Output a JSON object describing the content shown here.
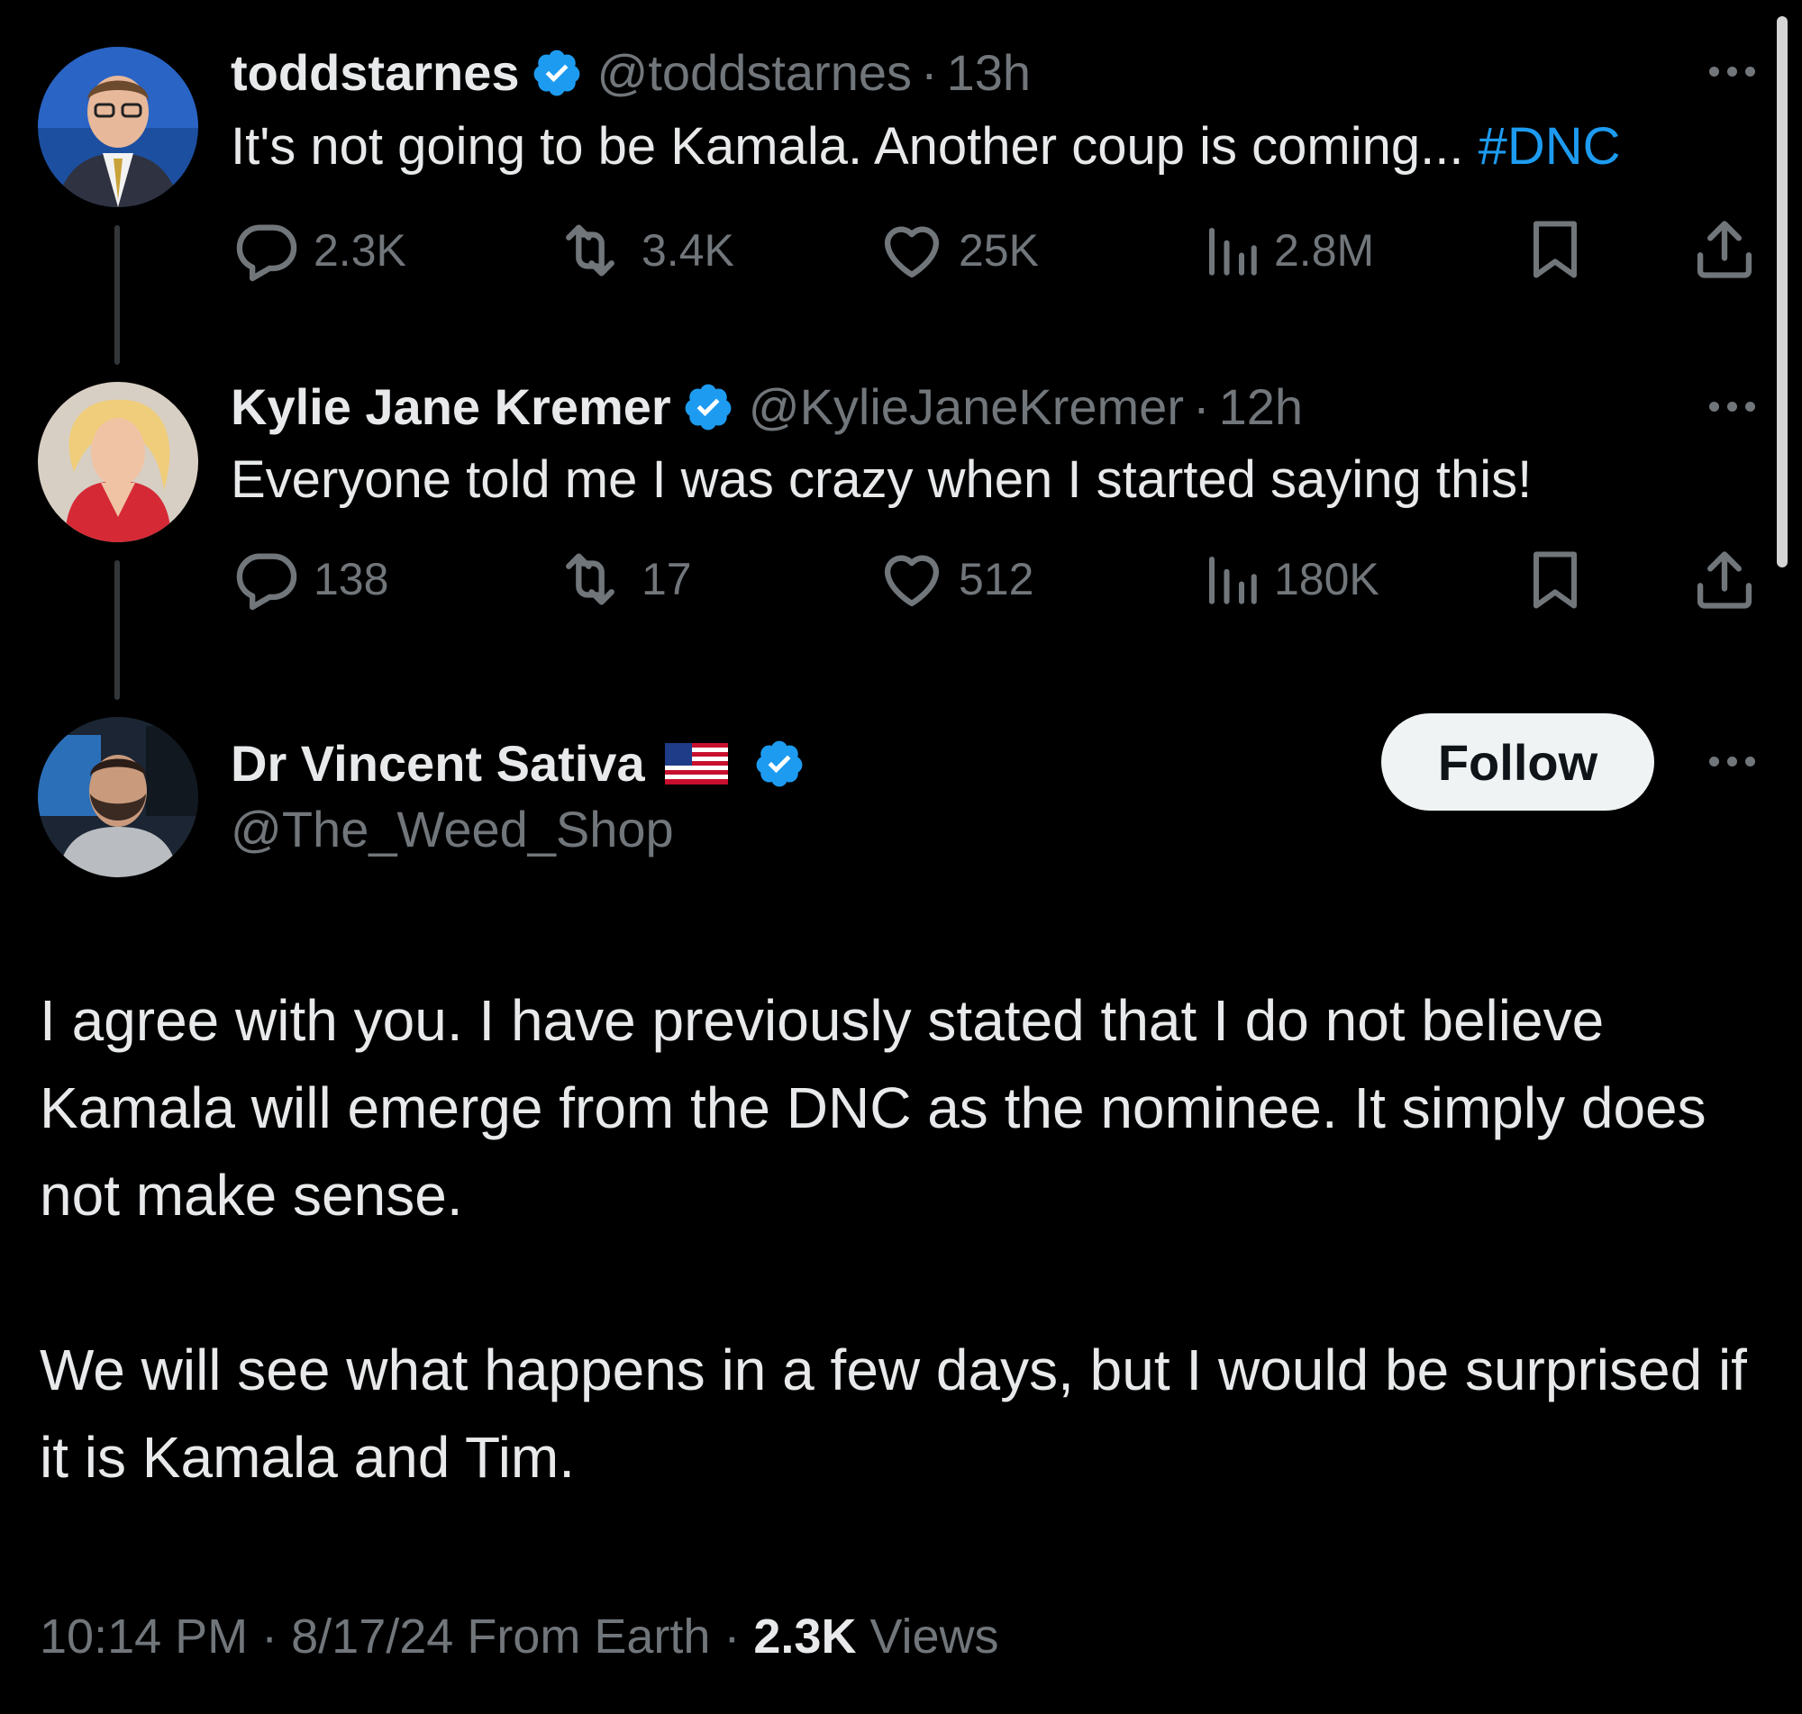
{
  "tweets": [
    {
      "name": "toddstarnes",
      "handle": "@toddstarnes",
      "sep": "·",
      "time": "13h",
      "text": "It's not going to be Kamala. Another coup is coming... ",
      "hashtag": "#DNC",
      "replies": "2.3K",
      "reposts": "3.4K",
      "likes": "25K",
      "views": "2.8M"
    },
    {
      "name": "Kylie Jane Kremer",
      "handle": "@KylieJaneKremer",
      "sep": "·",
      "time": "12h",
      "text": "Everyone told me I was crazy when I started saying this!",
      "replies": "138",
      "reposts": "17",
      "likes": "512",
      "views": "180K"
    }
  ],
  "main": {
    "name": "Dr Vincent Sativa",
    "handle": "@The_Weed_Shop",
    "follow_label": "Follow",
    "paragraphs": [
      "I agree with you. I have previously stated that I do not believe Kamala will emerge from the DNC as the nominee. It simply does not make sense.",
      "We will see what happens in a few days, but I would be surprised if it is Kamala and Tim."
    ],
    "time": "10:14 PM",
    "date": "8/17/24",
    "source": "From Earth",
    "views_count": "2.3K",
    "views_label": "Views"
  },
  "icons": {
    "verified": "verified-badge-icon",
    "reply": "reply-icon",
    "repost": "repost-icon",
    "like": "heart-icon",
    "views": "views-chart-icon",
    "bookmark": "bookmark-icon",
    "share": "share-icon",
    "more": "more-dots-icon",
    "flag": "us-flag-icon"
  },
  "colors": {
    "background": "#000000",
    "text": "#e7e9ea",
    "muted": "#71767b",
    "accent": "#1d9bf0",
    "follow_bg": "#eff3f4"
  }
}
